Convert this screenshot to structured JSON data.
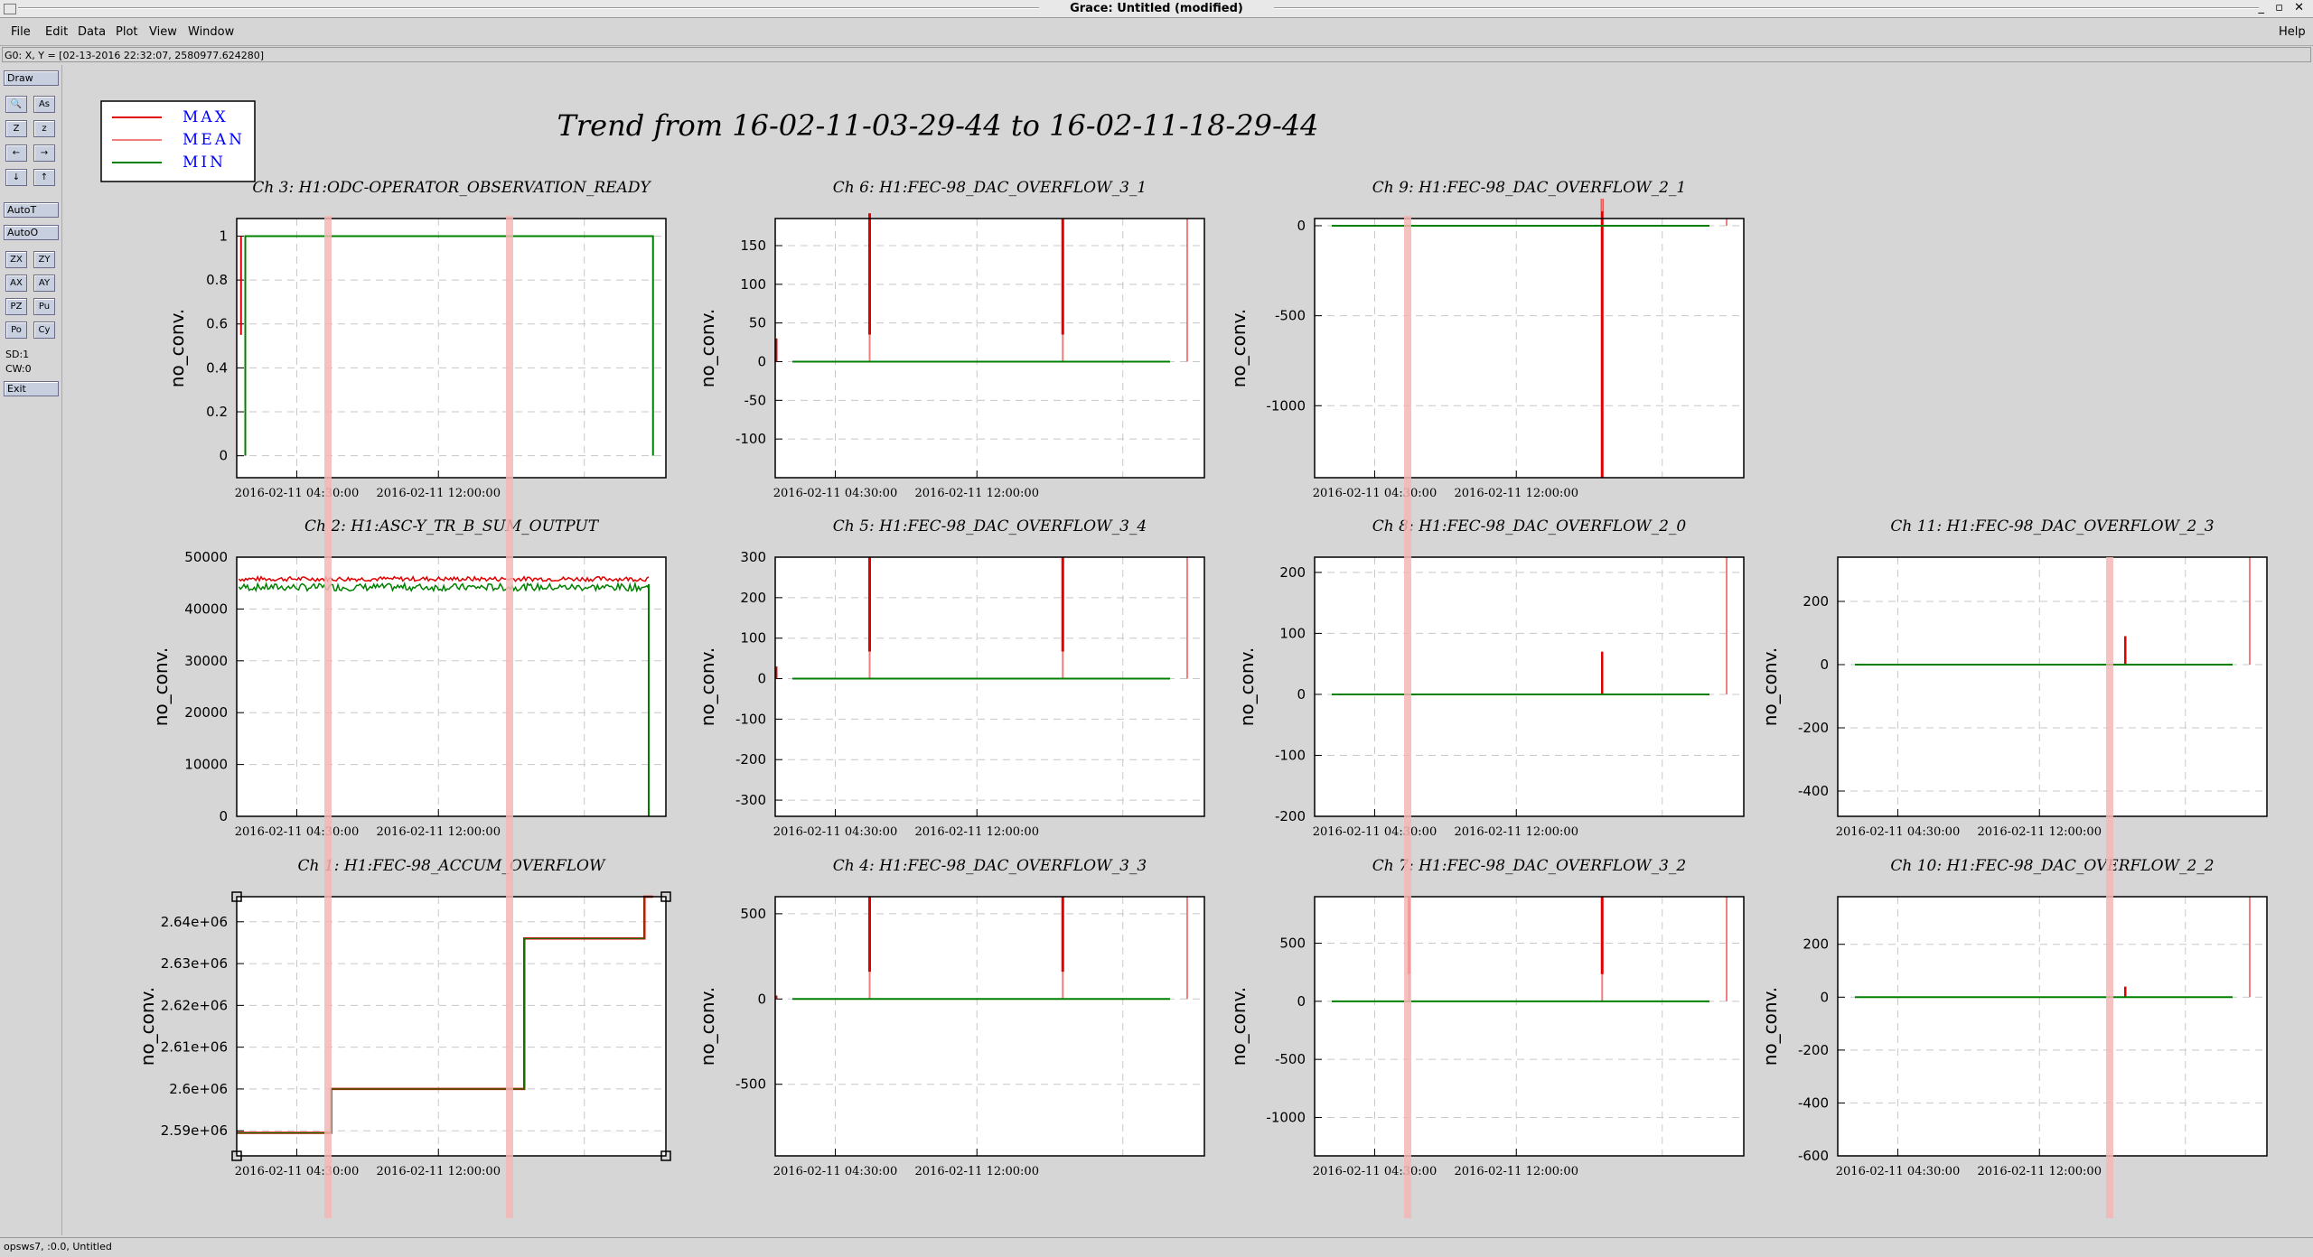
{
  "window": {
    "title": "Grace: Untitled (modified)",
    "controls": "_ ▫ ✕"
  },
  "menu": {
    "items": [
      "File",
      "Edit",
      "Data",
      "Plot",
      "View",
      "Window"
    ],
    "help": "Help"
  },
  "locator": "G0: X, Y = [02-13-2016 22:32:07, 2580977.624280]",
  "toolbox": {
    "draw": "Draw",
    "autoT": "AutoT",
    "autoO": "AutoO",
    "pairs1": [
      [
        "🔍",
        "As"
      ],
      [
        "Z",
        "z"
      ],
      [
        "←",
        "→"
      ],
      [
        "↓",
        "↑"
      ]
    ],
    "pairs2": [
      [
        "ZX",
        "ZY"
      ],
      [
        "AX",
        "AY"
      ],
      [
        "PZ",
        "Pu"
      ],
      [
        "Po",
        "Cy"
      ]
    ],
    "sd": "SD:1",
    "cw": "CW:0",
    "exit": "Exit"
  },
  "status": "opsws7, :0.0, Untitled",
  "main_title": "Trend from 16-02-11-03-29-44 to 16-02-11-18-29-44",
  "legend": [
    {
      "label": "MAX",
      "color": "#e00000"
    },
    {
      "label": "MEAN",
      "color": "#f08080"
    },
    {
      "label": "MIN",
      "color": "#008000"
    }
  ],
  "colors": {
    "max": "#e00000",
    "mean": "#f08080",
    "min": "#008000",
    "highlight": "#f4b6b6"
  },
  "chart_data": [
    {
      "type": "line",
      "title": "Ch 3: H1:ODC-OPERATOR_OBSERVATION_READY",
      "ylabel": "no_conv.",
      "xlabel": "",
      "x_ticks": [
        "2016-02-11 04:30:00",
        "2016-02-11 12:00:00"
      ],
      "ylim": [
        -0.1,
        1.08
      ],
      "y_ticks": [
        0,
        0.2,
        0.4,
        0.6,
        0.8,
        1
      ],
      "y_tick_labels": [
        "0",
        "0.2",
        "0.4",
        "0.6",
        "0.8",
        "1"
      ],
      "shape": "ready",
      "series": [
        {
          "name": "MAX",
          "values": []
        },
        {
          "name": "MEAN",
          "values": []
        },
        {
          "name": "MIN",
          "values": []
        }
      ]
    },
    {
      "type": "line",
      "title": "Ch 6: H1:FEC-98_DAC_OVERFLOW_3_1",
      "ylabel": "no_conv.",
      "xlabel": "",
      "x_ticks": [
        "2016-02-11 04:30:00",
        "2016-02-11 12:00:00"
      ],
      "ylim": [
        -150,
        185
      ],
      "y_ticks": [
        -100,
        -50,
        0,
        50,
        100,
        150
      ],
      "y_tick_labels": [
        "-100",
        "-50",
        "0",
        "50",
        "100",
        "150"
      ],
      "shape": "flat0",
      "spikes": [
        {
          "x": 0.22,
          "top": 1.02
        },
        {
          "x": 0.67,
          "top": 1.0
        }
      ],
      "tail": true,
      "start_spike": 30
    },
    {
      "type": "line",
      "title": "Ch 9: H1:FEC-98_DAC_OVERFLOW_2_1",
      "ylabel": "no_conv.",
      "xlabel": "",
      "x_ticks": [
        "2016-02-11 04:30:00",
        "2016-02-11 12:00:00"
      ],
      "ylim": [
        -1400,
        40
      ],
      "y_ticks": [
        -1000,
        -500,
        0
      ],
      "y_tick_labels": [
        "-1000",
        "-500",
        "0"
      ],
      "shape": "flat0",
      "spikes": [
        {
          "x": 0.67,
          "top": 0.0
        }
      ],
      "tail": true,
      "small_spike": {
        "x": 0.67,
        "v": 80
      }
    },
    {
      "type": "line",
      "title": "Ch 2: H1:ASC-Y_TR_B_SUM_OUTPUT",
      "ylabel": "no_conv.",
      "xlabel": "",
      "x_ticks": [
        "2016-02-11 04:30:00",
        "2016-02-11 12:00:00"
      ],
      "ylim": [
        0,
        50000
      ],
      "y_ticks": [
        0,
        10000,
        20000,
        30000,
        40000,
        50000
      ],
      "y_tick_labels": [
        "0",
        "10000",
        "20000",
        "30000",
        "40000",
        "50000"
      ],
      "shape": "noisy",
      "level_max": 45800,
      "level_min": 44800
    },
    {
      "type": "line",
      "title": "Ch 5: H1:FEC-98_DAC_OVERFLOW_3_4",
      "ylabel": "no_conv.",
      "xlabel": "",
      "x_ticks": [
        "2016-02-11 04:30:00",
        "2016-02-11 12:00:00"
      ],
      "ylim": [
        -340,
        300
      ],
      "y_ticks": [
        -300,
        -200,
        -100,
        0,
        100,
        200,
        300
      ],
      "y_tick_labels": [
        "-300",
        "-200",
        "-100",
        "0",
        "100",
        "200",
        "300"
      ],
      "shape": "flat0",
      "spikes": [
        {
          "x": 0.22,
          "top": 1.0
        },
        {
          "x": 0.67,
          "top": 1.0
        }
      ],
      "tail": true,
      "start_spike": 30
    },
    {
      "type": "line",
      "title": "Ch 8: H1:FEC-98_DAC_OVERFLOW_2_0",
      "ylabel": "no_conv.",
      "xlabel": "",
      "x_ticks": [
        "2016-02-11 04:30:00",
        "2016-02-11 12:00:00"
      ],
      "ylim": [
        -200,
        225
      ],
      "y_ticks": [
        -200,
        -100,
        0,
        100,
        200
      ],
      "y_tick_labels": [
        "-200",
        "-100",
        "0",
        "100",
        "200"
      ],
      "shape": "flat0",
      "spikes": [],
      "tail": true,
      "small_spike": {
        "x": 0.67,
        "v": 70
      }
    },
    {
      "type": "line",
      "title": "Ch 11: H1:FEC-98_DAC_OVERFLOW_2_3",
      "ylabel": "no_conv.",
      "xlabel": "",
      "x_ticks": [
        "2016-02-11 04:30:00",
        "2016-02-11 12:00:00"
      ],
      "ylim": [
        -480,
        340
      ],
      "y_ticks": [
        -400,
        -200,
        0,
        200
      ],
      "y_tick_labels": [
        "-400",
        "-200",
        "0",
        "200"
      ],
      "shape": "flat0",
      "spikes": [],
      "tail": true,
      "small_spike": {
        "x": 0.67,
        "v": 90
      }
    },
    {
      "type": "line",
      "title": "Ch 1: H1:FEC-98_ACCUM_OVERFLOW",
      "ylabel": "no_conv.",
      "xlabel": "",
      "x_ticks": [
        "2016-02-11 04:30:00",
        "2016-02-11 12:00:00"
      ],
      "ylim": [
        2584000,
        2646000
      ],
      "y_ticks": [
        2590000,
        2600000,
        2610000,
        2620000,
        2630000,
        2640000
      ],
      "y_tick_labels": [
        "2.59e+06",
        "2.6e+06",
        "2.61e+06",
        "2.62e+06",
        "2.63e+06",
        "2.64e+06"
      ],
      "shape": "steps",
      "steps": [
        [
          0,
          2589500
        ],
        [
          0.22,
          2600000
        ],
        [
          0.67,
          2636000
        ],
        [
          0.95,
          2646000
        ]
      ]
    },
    {
      "type": "line",
      "title": "Ch 4: H1:FEC-98_DAC_OVERFLOW_3_3",
      "ylabel": "no_conv.",
      "xlabel": "",
      "x_ticks": [
        "2016-02-11 04:30:00",
        "2016-02-11 12:00:00"
      ],
      "ylim": [
        -920,
        600
      ],
      "y_ticks": [
        -500,
        0,
        500
      ],
      "y_tick_labels": [
        "-500",
        "0",
        "500"
      ],
      "shape": "flat0",
      "spikes": [
        {
          "x": 0.22,
          "top": 1.0
        },
        {
          "x": 0.67,
          "top": 1.0
        }
      ],
      "tail": true,
      "start_spike": 20
    },
    {
      "type": "line",
      "title": "Ch 7: H1:FEC-98_DAC_OVERFLOW_3_2",
      "ylabel": "no_conv.",
      "xlabel": "",
      "x_ticks": [
        "2016-02-11 04:30:00",
        "2016-02-11 12:00:00"
      ],
      "ylim": [
        -1330,
        900
      ],
      "y_ticks": [
        -1000,
        -500,
        0,
        500
      ],
      "y_tick_labels": [
        "-1000",
        "-500",
        "0",
        "500"
      ],
      "shape": "flat0",
      "spikes": [
        {
          "x": 0.22,
          "top": 1.0
        },
        {
          "x": 0.67,
          "top": 1.0
        }
      ],
      "tail": true
    },
    {
      "type": "line",
      "title": "Ch 10: H1:FEC-98_DAC_OVERFLOW_2_2",
      "ylabel": "no_conv.",
      "xlabel": "",
      "x_ticks": [
        "2016-02-11 04:30:00",
        "2016-02-11 12:00:00"
      ],
      "ylim": [
        -600,
        380
      ],
      "y_ticks": [
        -600,
        -400,
        -200,
        0,
        200
      ],
      "y_tick_labels": [
        "-600",
        "-400",
        "-200",
        "0",
        "200"
      ],
      "shape": "flat0",
      "spikes": [],
      "tail": true,
      "small_spike": {
        "x": 0.67,
        "v": 40
      }
    }
  ]
}
